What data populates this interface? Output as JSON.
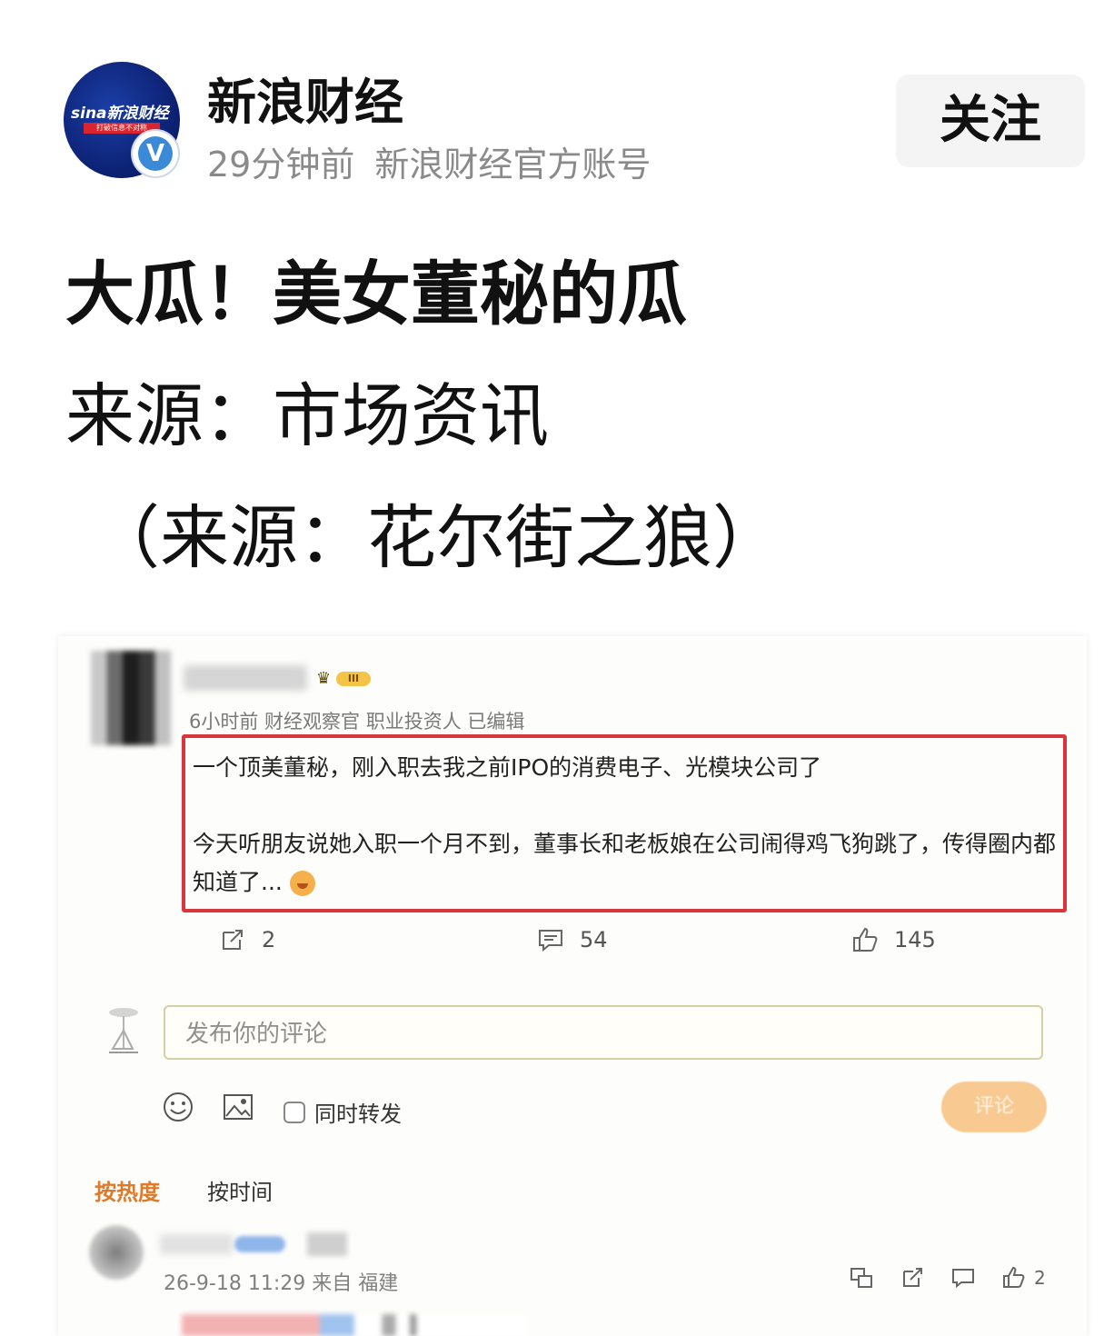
{
  "header": {
    "avatar_logo": "sina新浪财经",
    "avatar_slogan": "打破信息不对称",
    "account_name": "新浪财经",
    "time_ago": "29分钟前",
    "account_desc": "新浪财经官方账号",
    "follow_label": "关注",
    "verify_mark": "V"
  },
  "headline": {
    "line1": "大瓜！美女董秘的瓜",
    "line2": "来源：市场资讯",
    "line3": "（来源：花尔街之狼）"
  },
  "embedded_post": {
    "level_badge": "III",
    "meta": "6小时前 财经观察官 职业投资人 已编辑",
    "paragraph1": "一个顶美董秘，刚入职去我之前IPO的消费电子、光模块公司了",
    "paragraph2": "今天听朋友说她入职一个月不到，董事长和老板娘在公司闹得鸡飞狗跳了，传得圈内都知道了...",
    "repost_count": "2",
    "comment_count": "54",
    "like_count": "145"
  },
  "composer": {
    "placeholder": "发布你的评论",
    "repost_label": "同时转发",
    "submit_label": "评论"
  },
  "sort": {
    "hot_label": "按热度",
    "time_label": "按时间"
  },
  "first_reply": {
    "meta": "26-9-18 11:29 来自 福建",
    "like_count": "2"
  },
  "colors": {
    "highlight_border": "#d9353b",
    "sort_active": "#e07a2b",
    "submit_button": "#f8c991",
    "brand_blue": "#0a1d6b"
  }
}
